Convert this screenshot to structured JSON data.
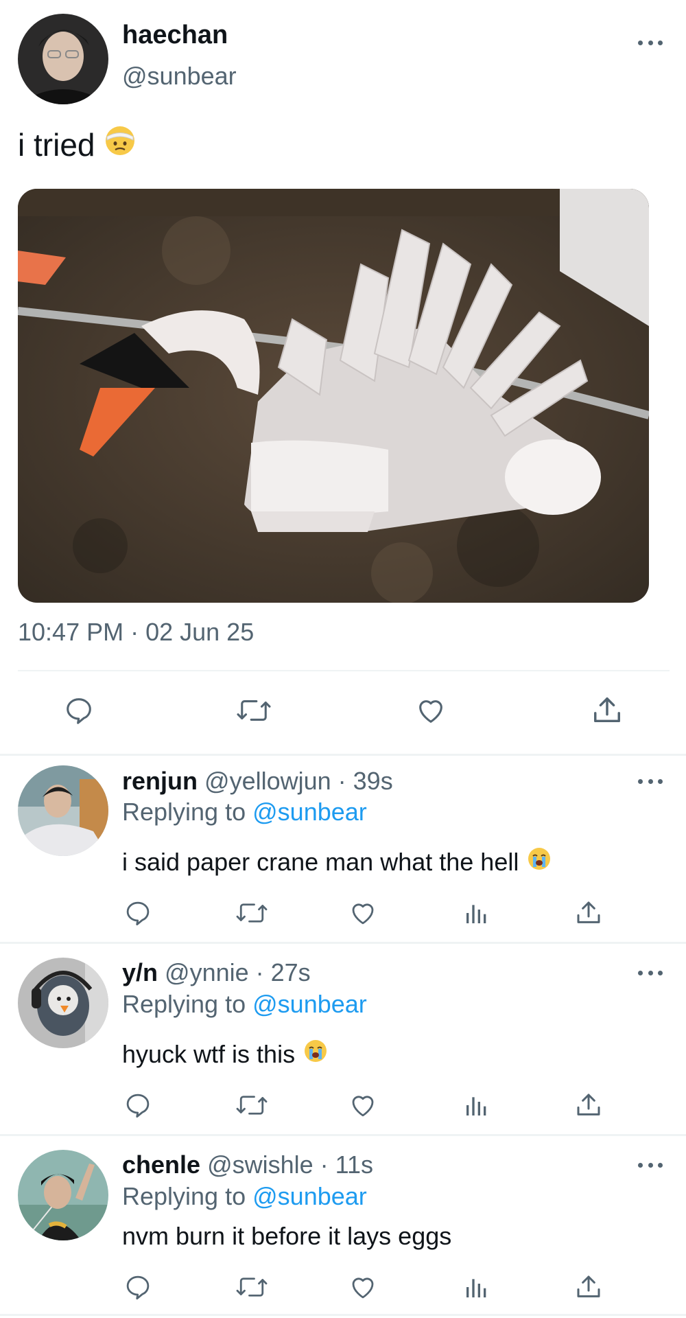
{
  "tweet": {
    "author_name": "haechan",
    "author_handle": "@sunbear",
    "text": "i tried",
    "text_emoji": "bandaged-face-emoji",
    "timestamp": "10:47 PM · 02 Jun 25",
    "actions": [
      "reply-icon",
      "retweet-icon",
      "like-icon",
      "share-icon"
    ]
  },
  "replies": [
    {
      "name": "renjun",
      "meta": "@yellowjun · 39s",
      "replying_prefix": "Replying to",
      "replying_handle": "@sunbear",
      "text": "i said paper crane man what the hell",
      "emoji": "loudly-crying-face-emoji"
    },
    {
      "name": "y/n",
      "meta": "@ynnie · 27s",
      "replying_prefix": "Replying to",
      "replying_handle": "@sunbear",
      "text": "hyuck wtf is this",
      "emoji": "loudly-crying-face-emoji"
    },
    {
      "name": "chenle",
      "meta": "@swishle · 11s",
      "replying_prefix": "Replying to",
      "replying_handle": "@sunbear",
      "text": "nvm burn it before it lays eggs",
      "emoji": ""
    }
  ],
  "reply_actions": [
    "reply-icon",
    "retweet-icon",
    "like-icon",
    "views-icon",
    "share-icon"
  ],
  "colors": {
    "text_primary": "#0f1419",
    "text_secondary": "#536471",
    "link": "#1d9bf0",
    "divider": "#eff3f4"
  }
}
